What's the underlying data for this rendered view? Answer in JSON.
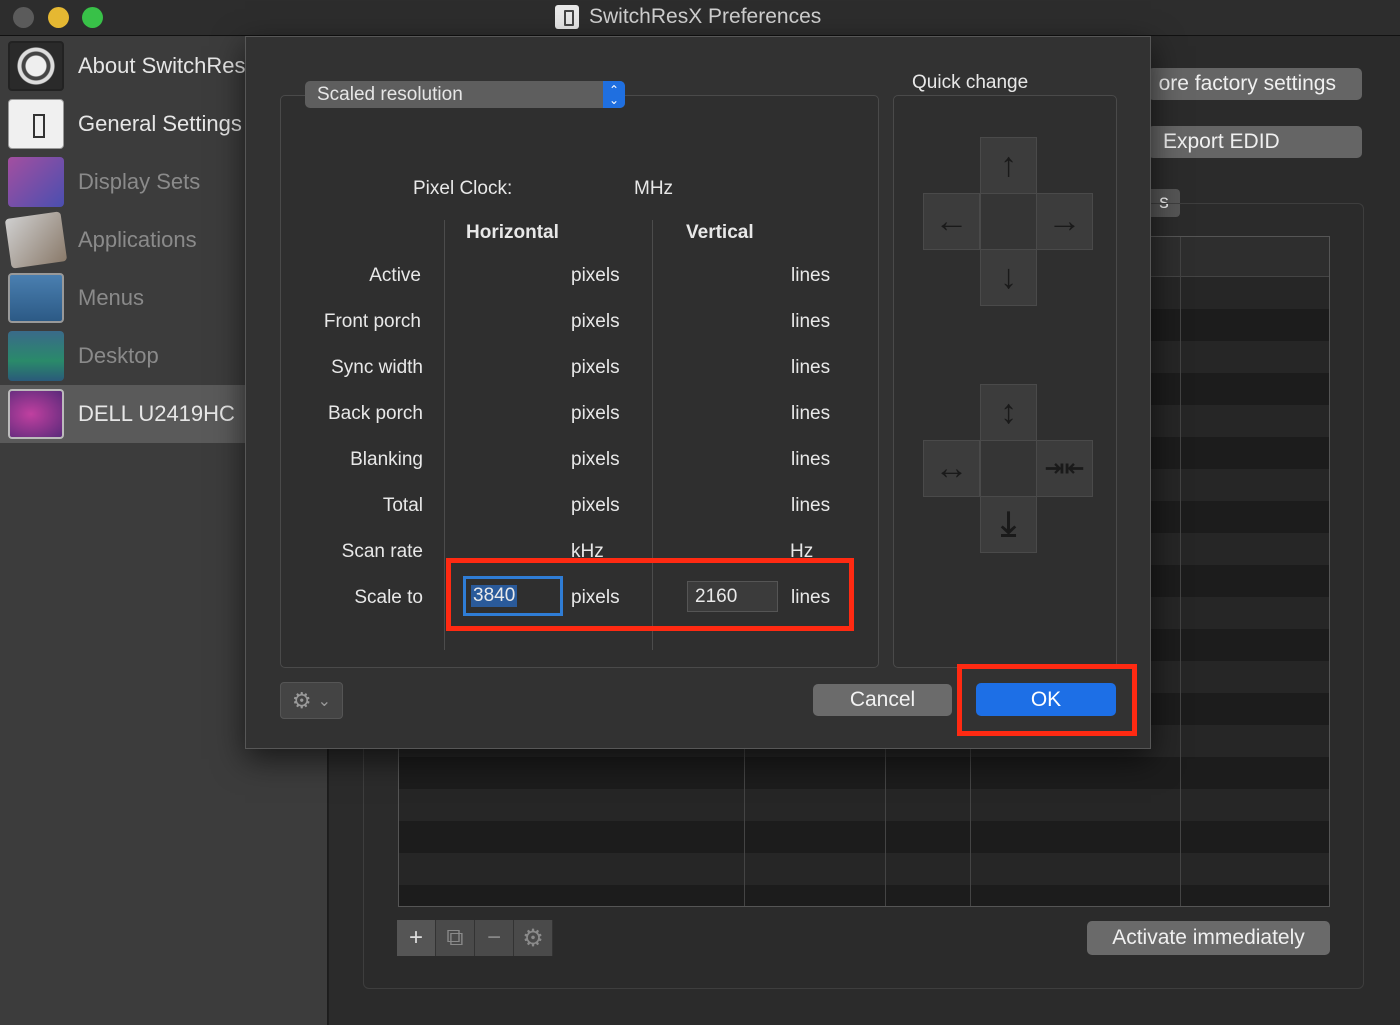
{
  "window": {
    "title": "SwitchResX Preferences"
  },
  "sidebar": {
    "items": [
      {
        "label": "About SwitchRes",
        "icon": "about-switchresx-icon"
      },
      {
        "label": "General Settings",
        "icon": "general-settings-icon"
      },
      {
        "label": "Display Sets",
        "icon": "display-sets-icon"
      },
      {
        "label": "Applications",
        "icon": "applications-icon"
      },
      {
        "label": "Menus",
        "icon": "menus-icon"
      },
      {
        "label": "Desktop",
        "icon": "desktop-icon"
      },
      {
        "label": "DELL U2419HC",
        "icon": "monitor-icon",
        "selected": true
      }
    ]
  },
  "background": {
    "restore_factory_label": "ore factory settings",
    "export_edid_label": "Export EDID",
    "tab_fragment": "s",
    "activate_label": "Activate immediately",
    "toolbar": {
      "add": "+",
      "duplicate": "⧉",
      "remove": "−",
      "settings": "⚙"
    }
  },
  "dialog": {
    "mode_popup": "Scaled resolution",
    "pixel_clock_label": "Pixel Clock:",
    "pixel_clock_unit": "MHz",
    "horizontal_header": "Horizontal",
    "vertical_header": "Vertical",
    "rows": [
      {
        "label": "Active",
        "h_unit": "pixels",
        "v_unit": "lines"
      },
      {
        "label": "Front porch",
        "h_unit": "pixels",
        "v_unit": "lines"
      },
      {
        "label": "Sync width",
        "h_unit": "pixels",
        "v_unit": "lines"
      },
      {
        "label": "Back porch",
        "h_unit": "pixels",
        "v_unit": "lines"
      },
      {
        "label": "Blanking",
        "h_unit": "pixels",
        "v_unit": "lines"
      },
      {
        "label": "Total",
        "h_unit": "pixels",
        "v_unit": "lines"
      },
      {
        "label": "Scan rate",
        "h_unit": "kHz",
        "v_unit": "Hz"
      }
    ],
    "scale_to": {
      "label": "Scale to",
      "h_value": "3840",
      "h_unit": "pixels",
      "v_value": "2160",
      "v_unit": "lines"
    },
    "quick_change_label": "Quick change",
    "move_arrows": {
      "up": "↑",
      "left": "←",
      "right": "→",
      "down": "↓"
    },
    "resize_arrows": {
      "up": "↕",
      "left": "↔",
      "right": "⇥⇤",
      "down": "⤓"
    },
    "cancel_label": "Cancel",
    "ok_label": "OK",
    "gear_menu": {
      "icon": "⚙",
      "chevron": "⌄"
    }
  },
  "colors": {
    "highlight_box": "#ff2a12",
    "ok_button": "#1d6fe6",
    "focus_ring": "#2f7dd6"
  }
}
